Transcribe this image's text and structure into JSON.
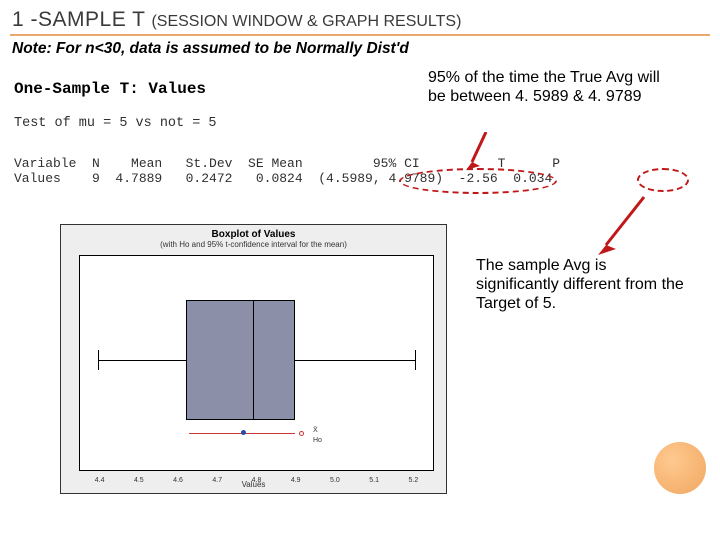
{
  "header": {
    "title_main": "1 -SAMPLE T ",
    "title_sub": "(SESSION WINDOW & GRAPH RESULTS)",
    "note": "Note:  For n<30, data is assumed to be Normally Dist'd"
  },
  "session": {
    "title": "One-Sample T: Values",
    "hypothesis": "Test of mu = 5 vs not = 5",
    "table_header": "Variable  N    Mean   St.Dev  SE Mean         95% CI          T      P",
    "table_row": "Values    9  4.7889   0.2472   0.0824  (4.5989, 4.9789)  -2.56  0.034"
  },
  "annotations": {
    "ci_text": "95% of the time the True Avg will be between 4. 5989 & 4. 9789",
    "p_text": "The sample Avg is significantly different from the Target of 5."
  },
  "chart_data": {
    "type": "boxplot",
    "title": "Boxplot of Values",
    "subtitle": "(with Ho and 95% t-confidence interval for the mean)",
    "xlabel": "Values",
    "ticks": [
      "4.4",
      "4.5",
      "4.6",
      "4.7",
      "4.8",
      "4.9",
      "5.0",
      "5.1",
      "5.2"
    ],
    "box": {
      "min": 4.45,
      "q1": 4.68,
      "median": 4.79,
      "q3": 4.86,
      "max": 5.15
    },
    "ci": {
      "low": 4.5989,
      "mean": 4.7889,
      "high": 4.9789
    },
    "ho": 5.0,
    "legend": [
      "X̄",
      "Ho"
    ]
  }
}
